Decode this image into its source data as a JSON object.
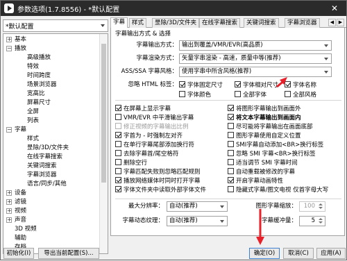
{
  "window": {
    "title": "参数选项(1.7.8556) - *默认配置",
    "close": "✕"
  },
  "profile": {
    "value": "*默认配置"
  },
  "tree": [
    {
      "label": "基本",
      "level": 0,
      "exp": "+"
    },
    {
      "label": "播放",
      "level": 0,
      "exp": "−"
    },
    {
      "label": "高级播放",
      "level": 1
    },
    {
      "label": "特效",
      "level": 1
    },
    {
      "label": "时间跨度",
      "level": 1
    },
    {
      "label": "场景浏览器",
      "level": 1
    },
    {
      "label": "宽高比",
      "level": 1
    },
    {
      "label": "屏幕尺寸",
      "level": 1
    },
    {
      "label": "全屏",
      "level": 1
    },
    {
      "label": "列表",
      "level": 1
    },
    {
      "label": "字幕",
      "level": 0,
      "exp": "−"
    },
    {
      "label": "样式",
      "level": 1
    },
    {
      "label": "昰除/3D/文件夹",
      "level": 1
    },
    {
      "label": "在线字幕搜索",
      "level": 1
    },
    {
      "label": "关键词搜索",
      "level": 1
    },
    {
      "label": "字幕浏览器",
      "level": 1
    },
    {
      "label": "语言/同步/其他",
      "level": 1
    },
    {
      "label": "设备",
      "level": 0,
      "exp": "+"
    },
    {
      "label": "滤镜",
      "level": 0,
      "exp": "+"
    },
    {
      "label": "视频",
      "level": 0,
      "exp": "+"
    },
    {
      "label": "声音",
      "level": 0,
      "exp": "+"
    },
    {
      "label": "3D 视频",
      "level": 0
    },
    {
      "label": "辅助",
      "level": 0
    },
    {
      "label": "存档",
      "level": 0
    }
  ],
  "tabs": [
    "字幕",
    "样式",
    "昰除/3D/文件夹",
    "在线字幕搜索",
    "关键词搜索",
    "字幕浏览器"
  ],
  "tab_nav": {
    "prev": "◀",
    "next": "▶"
  },
  "section_title": "字幕输出方式 & 选择",
  "output": {
    "label": "字幕输出方式：",
    "value": "输出到覆盖/VMR/EVR(高品质)"
  },
  "render": {
    "label": "字幕渲染方式：",
    "value": "矢量字串渲染 - 高速，质量中等(推荐)"
  },
  "ass": {
    "label": "ASS/SSA 字幕风格：",
    "value": "使用字串中所含风格(推荐)"
  },
  "html_ignore": {
    "label": "忽略 HTML 标签："
  },
  "html_tags": [
    {
      "label": "字体固定尺寸",
      "on": true
    },
    {
      "label": "字体相对尺寸",
      "on": true
    },
    {
      "label": "字体名称",
      "on": true
    },
    {
      "label": "字体颜色",
      "on": false
    },
    {
      "label": "全部字体",
      "on": false
    },
    {
      "label": "全部风格",
      "on": false
    }
  ],
  "checks_left": [
    {
      "label": "在屏幕上显示字幕",
      "on": true
    },
    {
      "label": "VMR/EVR 中平滑输出字幕",
      "on": false
    },
    {
      "label": "修正视频的字幕输出比例",
      "on": false,
      "disabled": true
    },
    {
      "label": "字首为 - 时强制左对齐",
      "on": true
    },
    {
      "label": "在单行字幕尾部添加换行符",
      "on": false
    },
    {
      "label": "去除字幕首/尾空格符",
      "on": false
    },
    {
      "label": "删除空行",
      "on": false
    },
    {
      "label": "字幕匹配失败则忽略匹配规则",
      "on": false
    },
    {
      "label": "播放网络媒体时同时打开字幕",
      "on": true
    },
    {
      "label": "字体文件夹中读取外部字体文件",
      "on": true
    }
  ],
  "checks_right": [
    {
      "label": "将图形字幕输出到画面外",
      "on": true
    },
    {
      "label": "将文本字幕输出到画面内",
      "on": true,
      "bold": true
    },
    {
      "label": "尽可能将字幕输出在画面底部",
      "on": false
    },
    {
      "label": "图形字幕使用自定义位置",
      "on": false
    },
    {
      "label": "SMI字幕自动添加<BR>换行标签",
      "on": false
    },
    {
      "label": "忽略 SMI 字幕<BR>换行标签",
      "on": false
    },
    {
      "label": "适当调节 SMI 字幕时间",
      "on": false
    },
    {
      "label": "自动重载被修改的字幕",
      "on": false
    },
    {
      "label": "开启字幕动画特性",
      "on": true
    },
    {
      "label": "隐藏式字幕/图文电视 仅首字母大写",
      "on": false
    }
  ],
  "max_res": {
    "label": "最大分辨率：",
    "value": "自动(推荐)"
  },
  "dyn_tex": {
    "label": "字幕动态纹理：",
    "value": "自动(推荐)"
  },
  "gfx_scale": {
    "label": "图形字幕缩放：",
    "value": "100"
  },
  "buffer": {
    "label": "字幕缓冲量：",
    "value": "5"
  },
  "buttons": {
    "init": "初始化(I)",
    "export": "导出当前配置(S)...",
    "ok": "确定(O)",
    "cancel": "取消(C)",
    "apply": "应用(A)"
  },
  "colors": {
    "titlebar": "#2b2b2b",
    "annotation": "#e8202a"
  }
}
